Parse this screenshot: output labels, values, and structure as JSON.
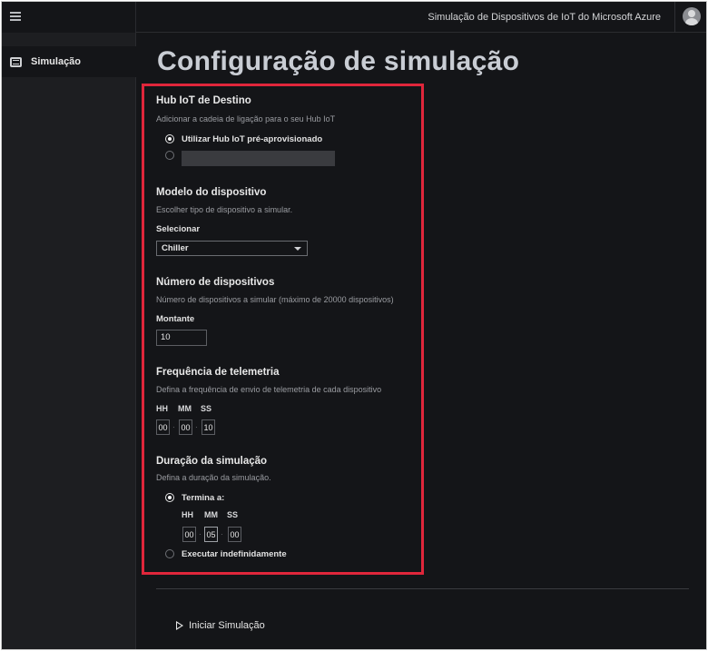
{
  "header": {
    "app_title": "Simulação de Dispositivos de IoT do Microsoft Azure",
    "menu_icon": "hamburger-icon",
    "avatar_icon": "user-avatar-icon"
  },
  "sidebar": {
    "items": [
      {
        "label": "Simulação",
        "icon": "simulation-icon"
      }
    ]
  },
  "page": {
    "title": "Configuração de simulação"
  },
  "hub": {
    "title": "Hub IoT de Destino",
    "description": "Adicionar a cadeia de ligação para o seu Hub IoT",
    "option_preprovisioned": "Utilizar Hub IoT pré-aprovisionado",
    "option_preprovisioned_selected": true,
    "connection_string_value": ""
  },
  "device_model": {
    "title": "Modelo do dispositivo",
    "description": "Escolher tipo de dispositivo a simular.",
    "select_label": "Selecionar",
    "selected_value": "Chiller"
  },
  "device_count": {
    "title": "Número de dispositivos",
    "description": "Número de dispositivos a simular (máximo de 20000 dispositivos)",
    "amount_label": "Montante",
    "amount_value": "10"
  },
  "telemetry": {
    "title": "Frequência de telemetria",
    "description": "Defina a frequência de envio de telemetria de cada dispositivo",
    "hh_label": "HH",
    "mm_label": "MM",
    "ss_label": "SS",
    "hh": "00",
    "mm": "00",
    "ss": "10"
  },
  "duration": {
    "title": "Duração da simulação",
    "description": "Defina a duração da simulação.",
    "ends_at_label": "Termina a:",
    "ends_at_selected": true,
    "hh_label": "HH",
    "mm_label": "MM",
    "ss_label": "SS",
    "hh": "00",
    "mm": "05",
    "ss": "00",
    "run_indefinitely_label": "Executar indefinidamente"
  },
  "actions": {
    "start_label": "Iniciar Simulação",
    "start_icon": "play-icon"
  },
  "colors": {
    "background": "#141518",
    "sidebar": "#1d1e21",
    "highlight_border": "#e0263b",
    "title_text": "#c9cdd4"
  }
}
